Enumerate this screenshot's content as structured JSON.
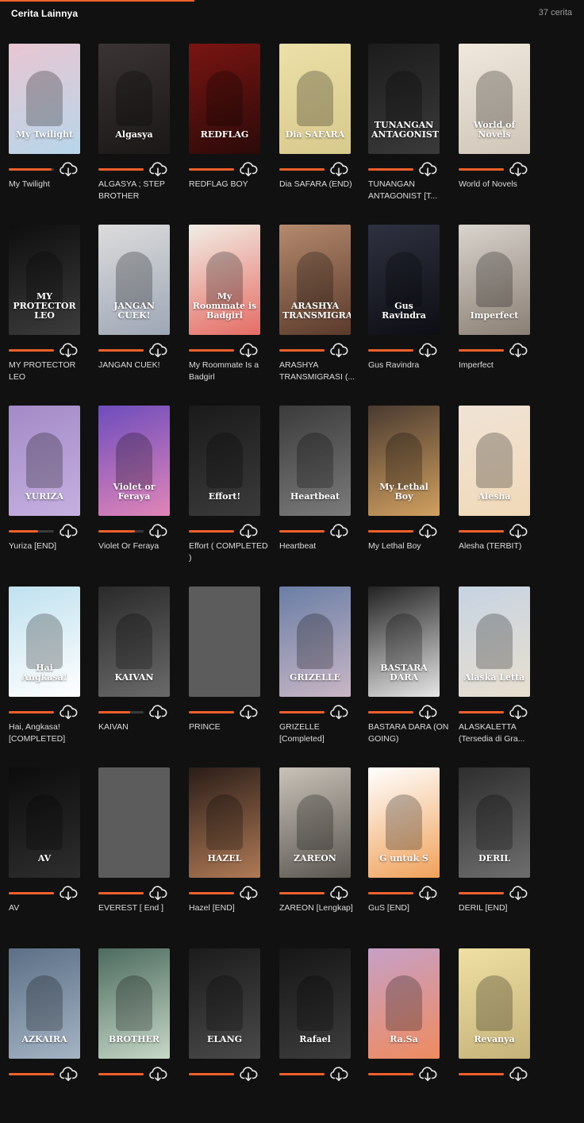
{
  "header": {
    "title": "Cerita Lainnya",
    "count": "37 cerita"
  },
  "stories": [
    {
      "title": "My Twilight",
      "cover_text": "My Twilight",
      "bg": "#e9c6d2",
      "bg2": "#b7d6ea",
      "progress": 0.95
    },
    {
      "title": "ALGASYA ; STEP BROTHER",
      "cover_text": "Algasya",
      "bg": "#3b3434",
      "bg2": "#1a1717",
      "progress": 1.0
    },
    {
      "title": "REDFLAG BOY",
      "cover_text": "REDFLAG",
      "bg": "#7a1512",
      "bg2": "#2b0a09",
      "progress": 1.0
    },
    {
      "title": "Dia SAFARA (END)",
      "cover_text": "Dia SAFARA",
      "bg": "#ece0a8",
      "bg2": "#d8c98c",
      "progress": 1.0
    },
    {
      "title": "TUNANGAN ANTAGONIST [T...",
      "cover_text": "TUNANGAN ANTAGONIST",
      "bg": "#1c1c1c",
      "bg2": "#3a3a3a",
      "progress": 1.0
    },
    {
      "title": "World of Novels",
      "cover_text": "World of Novels",
      "bg": "#efe8dc",
      "bg2": "#cfc6b8",
      "progress": 1.0
    },
    {
      "title": "MY PROTECTOR LEO",
      "cover_text": "MY PROTECTOR LEO",
      "bg": "#0e0e0e",
      "bg2": "#3c3c3c",
      "progress": 1.0
    },
    {
      "title": "JANGAN CUEK!",
      "cover_text": "JANGAN CUEK!",
      "bg": "#dcdcdc",
      "bg2": "#9ea7b6",
      "progress": 1.0
    },
    {
      "title": "My Roommate Is a Badgirl",
      "cover_text": "My Roommate is Badgirl",
      "bg": "#f1eee6",
      "bg2": "#e56c64",
      "progress": 1.0
    },
    {
      "title": "ARASHYA TRANSMIGRASI (...",
      "cover_text": "ARASHYA TRANSMIGRASI",
      "bg": "#b58a6e",
      "bg2": "#5a3a2b",
      "progress": 1.0
    },
    {
      "title": "Gus Ravindra",
      "cover_text": "Gus Ravindra",
      "bg": "#2e3140",
      "bg2": "#0d0e14",
      "progress": 1.0
    },
    {
      "title": "Imperfect",
      "cover_text": "Imperfect",
      "bg": "#d9d4cd",
      "bg2": "#8b7f74",
      "progress": 1.0
    },
    {
      "title": "Yuriza [END]",
      "cover_text": "YURIZA",
      "bg": "#a38ac7",
      "bg2": "#c6b0e0",
      "progress": 0.65
    },
    {
      "title": "Violet Or Feraya",
      "cover_text": "Violet or Feraya",
      "bg": "#6e4dbd",
      "bg2": "#e085b8",
      "progress": 0.8
    },
    {
      "title": "Effort ( COMPLETED )",
      "cover_text": "Effort!",
      "bg": "#1a1a1a",
      "bg2": "#3b3b3b",
      "progress": 1.0
    },
    {
      "title": "Heartbeat",
      "cover_text": "Heartbeat",
      "bg": "#3b3b3b",
      "bg2": "#7b7b7b",
      "progress": 1.0
    },
    {
      "title": "My Lethal Boy",
      "cover_text": "My Lethal Boy",
      "bg": "#4a3a30",
      "bg2": "#d1a060",
      "progress": 1.0
    },
    {
      "title": "Alesha (TERBIT)",
      "cover_text": "Alesha",
      "bg": "#efe3d6",
      "bg2": "#f1d9b8",
      "progress": 1.0
    },
    {
      "title": "Hai, Angkasa! [COMPLETED]",
      "cover_text": "Hai Angkasa!",
      "bg": "#bfe1ef",
      "bg2": "#ffffff",
      "progress": 1.0
    },
    {
      "title": "KAIVAN",
      "cover_text": "KAIVAN",
      "bg": "#2a2a2a",
      "bg2": "#6a6a6a",
      "progress": 0.7
    },
    {
      "title": "PRINCE",
      "cover_text": "",
      "bg": "#5c5c5c",
      "bg2": "#5c5c5c",
      "progress": 1.0
    },
    {
      "title": "GRIZELLE [Completed]",
      "cover_text": "GRIZELLE",
      "bg": "#6a7ea6",
      "bg2": "#c9b6c5",
      "progress": 1.0
    },
    {
      "title": "BASTARA DARA (ON GOING)",
      "cover_text": "BASTARA DARA",
      "bg": "#222",
      "bg2": "#e6e6e6",
      "progress": 1.0
    },
    {
      "title": "ALASKALETTA (Tersedia di Gra...",
      "cover_text": "Alaska Letta",
      "bg": "#c6d3e3",
      "bg2": "#e9dfcf",
      "progress": 1.0
    },
    {
      "title": "AV",
      "cover_text": "AV",
      "bg": "#0c0c0c",
      "bg2": "#2e2e2e",
      "progress": 1.0
    },
    {
      "title": "EVEREST [ End ]",
      "cover_text": "",
      "bg": "#5c5c5c",
      "bg2": "#5c5c5c",
      "progress": 1.0
    },
    {
      "title": "Hazel [END]",
      "cover_text": "HAZEL",
      "bg": "#2a1d18",
      "bg2": "#b07a56",
      "progress": 1.0
    },
    {
      "title": "ZAREON [Lengkap]",
      "cover_text": "ZAREON",
      "bg": "#c8c2b8",
      "bg2": "#5b5650",
      "progress": 1.0
    },
    {
      "title": "GuS [END]",
      "cover_text": "G untuk S",
      "bg": "#ffffff",
      "bg2": "#f0a15a",
      "progress": 1.0
    },
    {
      "title": "DERIL [END]",
      "cover_text": "DERIL",
      "bg": "#2e2e2e",
      "bg2": "#6e6e6e",
      "progress": 1.0
    },
    {
      "title": "",
      "cover_text": "AZKAIRA",
      "bg": "#5c6f86",
      "bg2": "#a4b4c4",
      "progress": 1.0
    },
    {
      "title": "",
      "cover_text": "BROTHER",
      "bg": "#4c6b5f",
      "bg2": "#c7d8c7",
      "progress": 1.0
    },
    {
      "title": "",
      "cover_text": "ELANG",
      "bg": "#1b1b1b",
      "bg2": "#4a4a4a",
      "progress": 1.0
    },
    {
      "title": "",
      "cover_text": "Rafael",
      "bg": "#161616",
      "bg2": "#3d3d3d",
      "progress": 1.0
    },
    {
      "title": "",
      "cover_text": "Ra.Sa",
      "bg": "#c6a0c7",
      "bg2": "#ef8b5f",
      "progress": 1.0
    },
    {
      "title": "",
      "cover_text": "Revanya",
      "bg": "#efe0a2",
      "bg2": "#c5b27a",
      "progress": 1.0
    }
  ],
  "colors": {
    "accent": "#f0602c",
    "background": "#111111"
  },
  "icons": {
    "download": "cloud-download-icon"
  }
}
